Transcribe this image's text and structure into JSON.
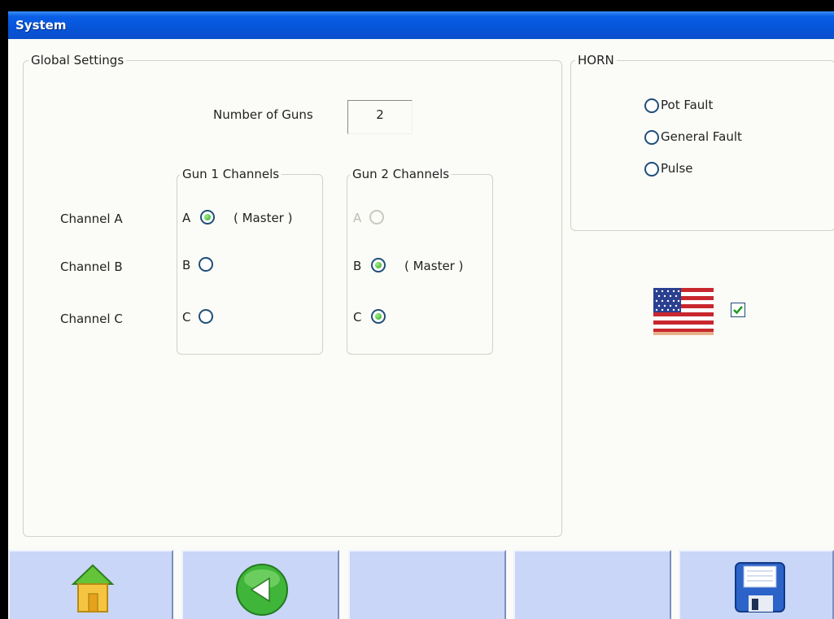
{
  "window": {
    "title": "System"
  },
  "global_settings": {
    "legend": "Global Settings",
    "number_of_guns_label": "Number of Guns",
    "number_of_guns_value": "2",
    "channel_labels": [
      "Channel A",
      "Channel B",
      "Channel C"
    ],
    "gun1": {
      "legend": "Gun 1 Channels",
      "letters": [
        "A",
        "B",
        "C"
      ],
      "selected": [
        true,
        false,
        false
      ],
      "master_note": "( Master )"
    },
    "gun2": {
      "legend": "Gun 2 Channels",
      "letters": [
        "A",
        "B",
        "C"
      ],
      "selected": [
        false,
        true,
        true
      ],
      "disabled": [
        true,
        false,
        false
      ],
      "master_note": "( Master )"
    }
  },
  "horn": {
    "legend": "HORN",
    "options": [
      "Pot Fault",
      "General Fault",
      "Pulse"
    ],
    "selected": [
      false,
      false,
      false
    ]
  },
  "language": {
    "flag": "us-flag-icon",
    "checked": true
  },
  "toolbar": {
    "buttons": [
      "home-icon",
      "back-arrow-icon",
      "",
      "",
      "save-disk-icon"
    ]
  },
  "colors": {
    "title_bar": "#0a5fe6",
    "radio_selected": "#2ea620",
    "button_face": "#c9d6f7"
  }
}
